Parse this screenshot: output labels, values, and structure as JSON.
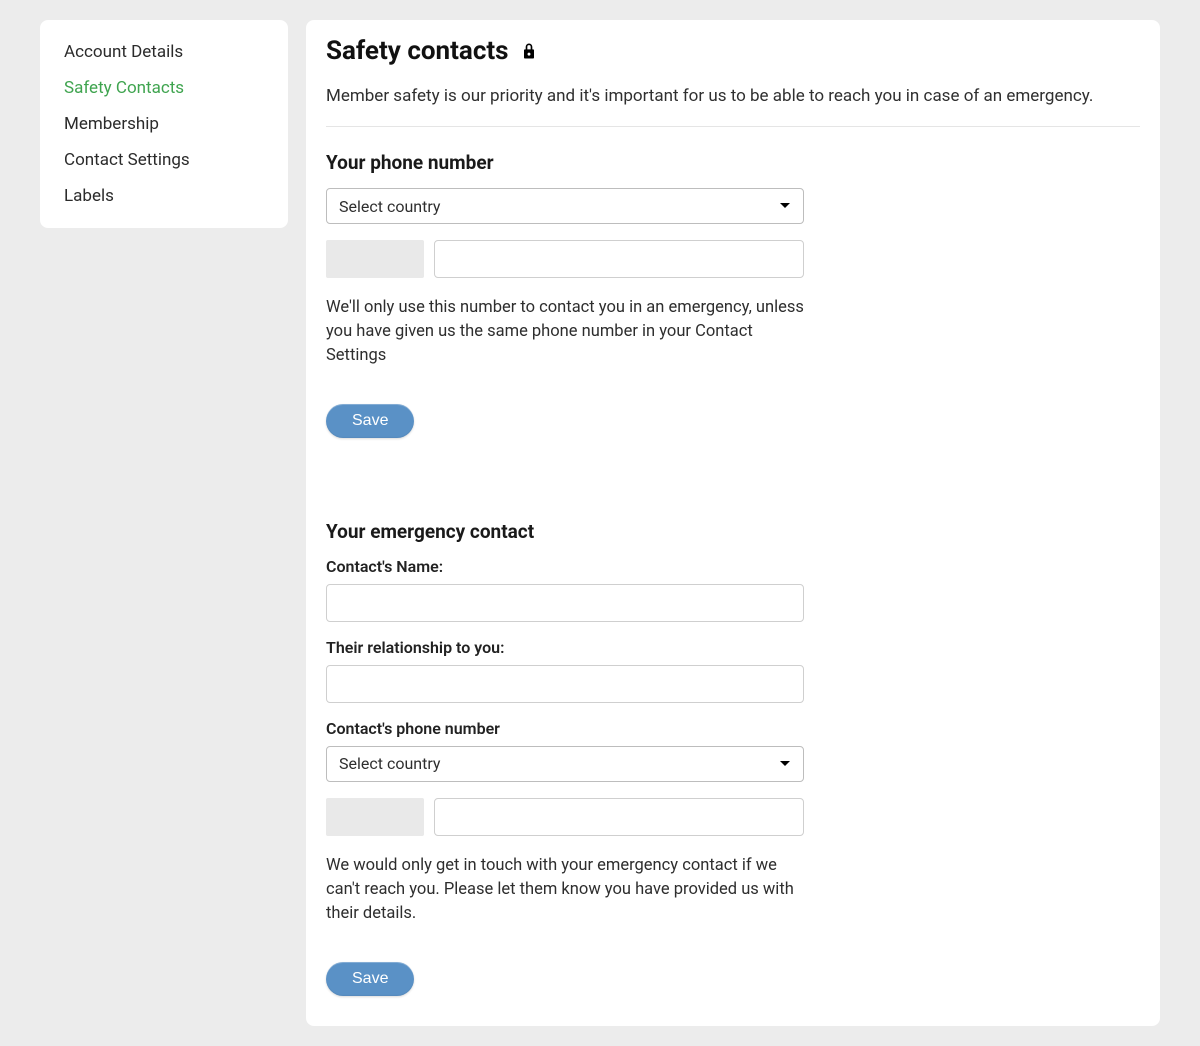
{
  "sidebar": {
    "items": [
      {
        "label": "Account Details",
        "active": false
      },
      {
        "label": "Safety Contacts",
        "active": true
      },
      {
        "label": "Membership",
        "active": false
      },
      {
        "label": "Contact Settings",
        "active": false
      },
      {
        "label": "Labels",
        "active": false
      }
    ]
  },
  "page": {
    "title": "Safety contacts",
    "intro": "Member safety is our priority and it's important for us to be able to reach you in case of an emergency."
  },
  "your_phone": {
    "section_title": "Your phone number",
    "country_placeholder": "Select country",
    "country_value": "Select country",
    "prefix_value": "",
    "number_value": "",
    "help_text": "We'll only use this number to contact you in an emergency, unless you have given us the same phone number in your Contact Settings",
    "save_label": "Save"
  },
  "emergency_contact": {
    "section_title": "Your emergency contact",
    "name_label": "Contact's Name:",
    "name_value": "",
    "relationship_label": "Their relationship to you:",
    "relationship_value": "",
    "phone_section_label": "Contact's phone number",
    "country_placeholder": "Select country",
    "country_value": "Select country",
    "prefix_value": "",
    "number_value": "",
    "help_text": "We would only get in touch with your emergency contact if we can't reach you. Please let them know you have provided us with their details.",
    "save_label": "Save"
  }
}
